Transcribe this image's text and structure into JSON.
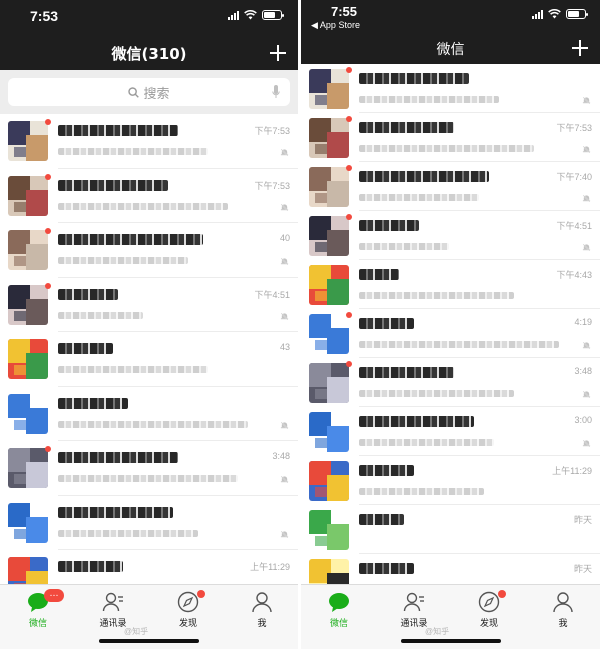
{
  "left": {
    "status_time": "7:53",
    "nav_title": "微信(310)",
    "search_placeholder": "搜索",
    "rows": [
      {
        "time": "下午7:53",
        "badge": true,
        "muted": true,
        "colors": [
          "#3a3a5a",
          "#c89a6a",
          "#e9e3d8"
        ]
      },
      {
        "time": "下午7:53",
        "badge": true,
        "muted": true,
        "colors": [
          "#6a4c3a",
          "#b04a4a",
          "#d8c8b8"
        ]
      },
      {
        "time": "40",
        "badge": true,
        "muted": true,
        "colors": [
          "#8a6a5a",
          "#c8b8a8",
          "#e8d8c8"
        ]
      },
      {
        "time": "下午4:51",
        "badge": true,
        "muted": true,
        "colors": [
          "#2a2a3a",
          "#6a5a5a",
          "#d8c8c8"
        ]
      },
      {
        "time": "43",
        "badge": false,
        "muted": false,
        "colors": [
          "#f1c232",
          "#3a9a4a",
          "#e84a3a"
        ]
      },
      {
        "time": "",
        "badge": false,
        "muted": true,
        "colors": [
          "#3a7ad8",
          "#3a7ad8",
          "#ffffff"
        ]
      },
      {
        "time": "3:48",
        "badge": true,
        "muted": true,
        "colors": [
          "#8a8a9a",
          "#c8c8d8",
          "#5a5a6a"
        ]
      },
      {
        "time": "",
        "badge": false,
        "muted": true,
        "colors": [
          "#2a6ac8",
          "#4a8ae8",
          "#ffffff"
        ]
      },
      {
        "time": "上午11:29",
        "badge": false,
        "muted": false,
        "colors": [
          "#e84a3a",
          "#f1c232",
          "#3a6ac8"
        ]
      }
    ],
    "tabs": [
      {
        "label": "微信",
        "icon": "chat-bubble-icon"
      },
      {
        "label": "通讯录",
        "icon": "contacts-icon"
      },
      {
        "label": "发现",
        "icon": "compass-icon"
      },
      {
        "label": "我",
        "icon": "person-icon"
      }
    ],
    "chat_badge": "…",
    "watermark": "@知乎"
  },
  "right": {
    "status_time": "7:55",
    "back_app": "◀ App Store",
    "nav_title": "微信",
    "rows": [
      {
        "time": "",
        "badge": true,
        "muted": true,
        "colors": [
          "#3a3a5a",
          "#c89a6a",
          "#e9e3d8"
        ]
      },
      {
        "time": "下午7:53",
        "badge": true,
        "muted": true,
        "colors": [
          "#6a4c3a",
          "#b04a4a",
          "#d8c8b8"
        ]
      },
      {
        "time": "下午7:40",
        "badge": true,
        "muted": true,
        "colors": [
          "#8a6a5a",
          "#c8b8a8",
          "#e8d8c8"
        ]
      },
      {
        "time": "下午4:51",
        "badge": true,
        "muted": true,
        "colors": [
          "#2a2a3a",
          "#6a5a5a",
          "#d8c8c8"
        ]
      },
      {
        "time": "下午4:43",
        "badge": false,
        "muted": false,
        "colors": [
          "#f1c232",
          "#3a9a4a",
          "#e84a3a"
        ]
      },
      {
        "time": "4:19",
        "badge": true,
        "muted": true,
        "colors": [
          "#3a7ad8",
          "#3a7ad8",
          "#ffffff"
        ]
      },
      {
        "time": "3:48",
        "badge": true,
        "muted": true,
        "colors": [
          "#8a8a9a",
          "#c8c8d8",
          "#5a5a6a"
        ]
      },
      {
        "time": "3:00",
        "badge": false,
        "muted": true,
        "colors": [
          "#2a6ac8",
          "#4a8ae8",
          "#ffffff"
        ]
      },
      {
        "time": "上午11:29",
        "badge": false,
        "muted": false,
        "colors": [
          "#e84a3a",
          "#f1c232",
          "#3a6ac8"
        ]
      },
      {
        "time": "昨天",
        "badge": false,
        "muted": false,
        "colors": [
          "#3aa84a",
          "#7ac86a",
          "#ffffff"
        ]
      },
      {
        "time": "昨天",
        "badge": false,
        "muted": false,
        "colors": [
          "#f1c232",
          "#2a2a2a",
          "#fff2a8"
        ]
      }
    ],
    "tabs": [
      {
        "label": "微信",
        "icon": "chat-bubble-icon"
      },
      {
        "label": "通讯录",
        "icon": "contacts-icon"
      },
      {
        "label": "发现",
        "icon": "compass-icon"
      },
      {
        "label": "我",
        "icon": "person-icon"
      }
    ],
    "watermark": "@知乎"
  },
  "colors": {
    "accent": "#1aad19",
    "badge": "#f24a3e",
    "bar": "#1e1e1e"
  }
}
